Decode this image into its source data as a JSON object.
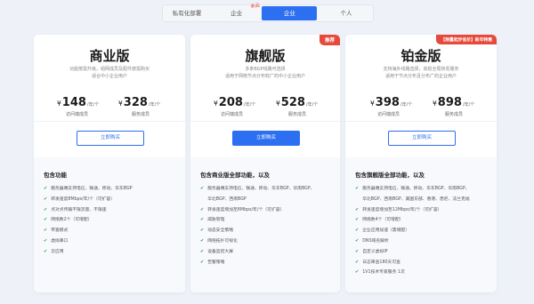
{
  "tabs": [
    {
      "label": "私有化部署"
    },
    {
      "label": "企业",
      "badge": "新品"
    },
    {
      "label": "企业"
    },
    {
      "label": "个人"
    }
  ],
  "plans": [
    {
      "name": "商业版",
      "desc_line1": "功能按需升级，组网成员及配件按需购买",
      "desc_line2": "适合中小企业用户",
      "price1": {
        "currency": "¥",
        "amount": "148",
        "unit": "/年/个",
        "label": "访问端成员"
      },
      "price2": {
        "currency": "¥",
        "amount": "328",
        "unit": "/年/个",
        "label": "服务成员"
      },
      "button": "立即购买",
      "features_title": "包含功能",
      "features": [
        "服务器端支持电信、联通、移动、华东BGP",
        "转发速度8Mbps/年/个（可扩容）",
        "点对点传输不限流量、不限速",
        "网络数2个（可增配）",
        "带宽模式",
        "虚拟串口",
        "云应用"
      ]
    },
    {
      "name": "旗舰版",
      "ribbon": "推荐",
      "desc_line1": "多条BGP线路可选择",
      "desc_line2": "适用于网络节点分布较广的中小企业用户",
      "price1": {
        "currency": "¥",
        "amount": "208",
        "unit": "/年/个",
        "label": "访问端成员"
      },
      "price2": {
        "currency": "¥",
        "amount": "528",
        "unit": "/年/个",
        "label": "服务成员"
      },
      "button": "立即购买",
      "features_title": "包含商业版全部功能，以及",
      "features": [
        "服务器端支持电信、联通、移动、华东BGP、华南BGP、",
        "华北BGP、西南BGP",
        "转发速度增加至8Mbps/年/个（可扩容）",
        "威胁管理",
        "动态安全策略",
        "网络拓扑可视化",
        "设备监控大屏",
        "告警策略"
      ]
    },
    {
      "name": "铂金版",
      "ribbon": "【限量起步低价】新年特惠",
      "desc_line1": "支持海外线路选择，高稳全局转发服务",
      "desc_line2": "适用于节点分布且分布广的企业用户",
      "price1": {
        "currency": "¥",
        "amount": "398",
        "unit": "/年/个",
        "label": "访问端成员"
      },
      "price2": {
        "currency": "¥",
        "amount": "898",
        "unit": "/年/个",
        "label": "服务成员"
      },
      "button": "立即购买",
      "features_title": "包含旗舰版全部功能，以及",
      "features": [
        "服务器端支持电信、联通、移动、华东BGP、华南BGP、",
        "华北BGP、西南BGP、美国东部、香港、悉尼、法兰克福",
        "转发速度增加至12Mbps/年/个（可扩容）",
        "网络数4个（可增配）",
        "企业应用加速（需增配）",
        "DNS域名解析",
        "自定义虚拟IP",
        "日志审查180天可查",
        "1V1技术专家服务 1次"
      ]
    }
  ],
  "colors": {
    "accent": "#2d6ff1",
    "ribbon": "#e74a3b",
    "check": "#22a648"
  }
}
